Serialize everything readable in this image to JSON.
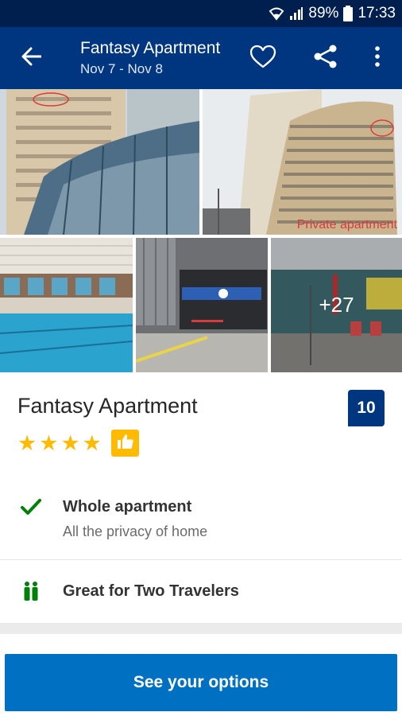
{
  "status_bar": {
    "battery": "89%",
    "time": "17:33"
  },
  "header": {
    "title": "Fantasy Apartment",
    "dates": "Nov 7 - Nov 8",
    "icons": [
      "back-arrow-icon",
      "heart-icon",
      "share-icon",
      "more-vert-icon"
    ]
  },
  "gallery": {
    "photo_caption": "Private apartment",
    "more_count": "+27"
  },
  "property": {
    "name": "Fantasy Apartment",
    "score": "10",
    "star_count": 4,
    "stars": [
      "★",
      "★",
      "★",
      "★"
    ],
    "accent_color": "#febb02"
  },
  "facilities": [
    {
      "icon": "check-icon",
      "title": "Whole apartment",
      "subtitle": "All the privacy of home"
    },
    {
      "icon": "two-people-icon",
      "title": "Great for Two Travelers"
    }
  ],
  "cta": {
    "label": "See your options"
  },
  "colors": {
    "brand": "#003580",
    "status_bar": "#001f4f",
    "cta": "#0071c2",
    "check": "#008009"
  }
}
